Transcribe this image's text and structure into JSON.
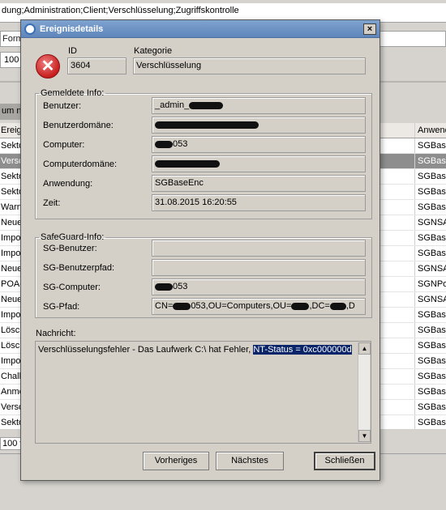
{
  "background": {
    "path_text": "dung;Administration;Client;Verschlüsselung;Zugriffskontrolle",
    "format_label": "Forma",
    "count_value": "100",
    "col_header_left": "um na",
    "left_column": [
      "Ereign",
      "Sekto",
      "Versch",
      "Sekto",
      "Sekto",
      "Warnu",
      "Neue",
      "Impor",
      "Impor",
      "Neue",
      "POA-E",
      "Neue",
      "Impor",
      "Lösch",
      "Lösch",
      "Impor",
      "Challe",
      "Anme",
      "Versch",
      "Sekto"
    ],
    "right_header": [
      "",
      "Anwend"
    ],
    "right_rows": [
      [
        "ng",
        "SGBase"
      ],
      [
        "ng",
        "SGBase"
      ],
      [
        "ng",
        "SGBase"
      ],
      [
        "ng",
        "SGBase"
      ],
      [
        "ng",
        "SGBase"
      ],
      [
        "",
        "SGNSAS"
      ],
      [
        "",
        "SGBase"
      ],
      [
        "",
        "SGBase"
      ],
      [
        "",
        "SGNSAS"
      ],
      [
        "",
        "SGNPoa"
      ],
      [
        "",
        "SGNSAS"
      ],
      [
        "",
        "SGBase"
      ],
      [
        "",
        "SGBase"
      ],
      [
        "",
        "SGBase"
      ],
      [
        "",
        "SGBase"
      ],
      [
        "",
        "SGBase"
      ],
      [
        "",
        "SGBase"
      ],
      [
        "ng",
        "SGBase"
      ],
      [
        "ng",
        "SGBase"
      ]
    ],
    "selected_index": 1,
    "footer_text": "100 v"
  },
  "dialog": {
    "title": "Ereignisdetails",
    "close_label": "×",
    "id_label": "ID",
    "id_value": "3604",
    "category_label": "Kategorie",
    "category_value": "Verschlüsselung",
    "gemeldete": {
      "legend": "Gemeldete Info:",
      "benutzer_label": "Benutzer:",
      "benutzer_value": "_admin_",
      "benutzerdomaene_label": "Benutzerdomäne:",
      "computer_label": "Computer:",
      "computer_value": "053",
      "computerdomaene_label": "Computerdomäne:",
      "anwendung_label": "Anwendung:",
      "anwendung_value": "SGBaseEnc",
      "zeit_label": "Zeit:",
      "zeit_value": "31.08.2015 16:20:55"
    },
    "safeguard": {
      "legend": "SafeGuard-Info:",
      "sg_benutzer_label": "SG-Benutzer:",
      "sg_benutzerpfad_label": "SG-Benutzerpfad:",
      "sg_computer_label": "SG-Computer:",
      "sg_computer_value": "053",
      "sg_pfad_label": "SG-Pfad:",
      "sg_pfad_p1": "CN=",
      "sg_pfad_p2": "053,OU=Computers,OU=",
      "sg_pfad_p3": ",DC=",
      "sg_pfad_p4": ",D"
    },
    "nachricht_label": "Nachricht:",
    "nachricht_text": "Verschlüsselungsfehler - Das Laufwerk C:\\ hat Fehler, ",
    "nachricht_selected": "NT-Status = 0xc000000d",
    "buttons": {
      "previous": "Vorheriges",
      "next": "Nächstes",
      "close": "Schließen"
    }
  },
  "colors": {
    "title_bar": "#6a91c4",
    "selection": "#0a246a",
    "error_icon": "#c81e1e"
  },
  "icons": [
    "info-icon",
    "error-icon",
    "scroll-up-icon",
    "scroll-down-icon"
  ]
}
